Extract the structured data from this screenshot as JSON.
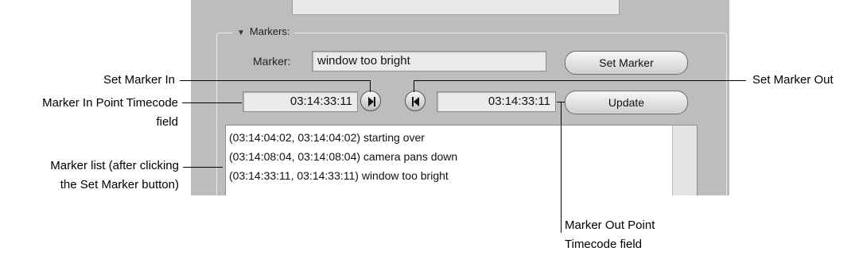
{
  "group": {
    "title": "Markers:"
  },
  "marker": {
    "label": "Marker:",
    "value": "window too bright"
  },
  "buttons": {
    "set_marker": "Set Marker",
    "update": "Update"
  },
  "timecodes": {
    "in": "03:14:33:11",
    "out": "03:14:33:11"
  },
  "marker_list": [
    "(03:14:04:02, 03:14:04:02) starting over",
    "(03:14:08:04, 03:14:08:04) camera pans down",
    "(03:14:33:11, 03:14:33:11) window too bright"
  ],
  "callouts": {
    "set_marker_in": "Set Marker In",
    "set_marker_out": "Set Marker Out",
    "in_timecode_line1": "Marker In Point Timecode",
    "in_timecode_line2": "field",
    "list_line1": "Marker list (after clicking",
    "list_line2": "the Set Marker button)",
    "out_timecode_line1": "Marker Out Point",
    "out_timecode_line2": "Timecode field"
  },
  "icons": {
    "set_in": "play-to-end-icon",
    "set_out": "skip-to-start-icon",
    "disclosure": "disclosure-triangle-down-icon"
  }
}
